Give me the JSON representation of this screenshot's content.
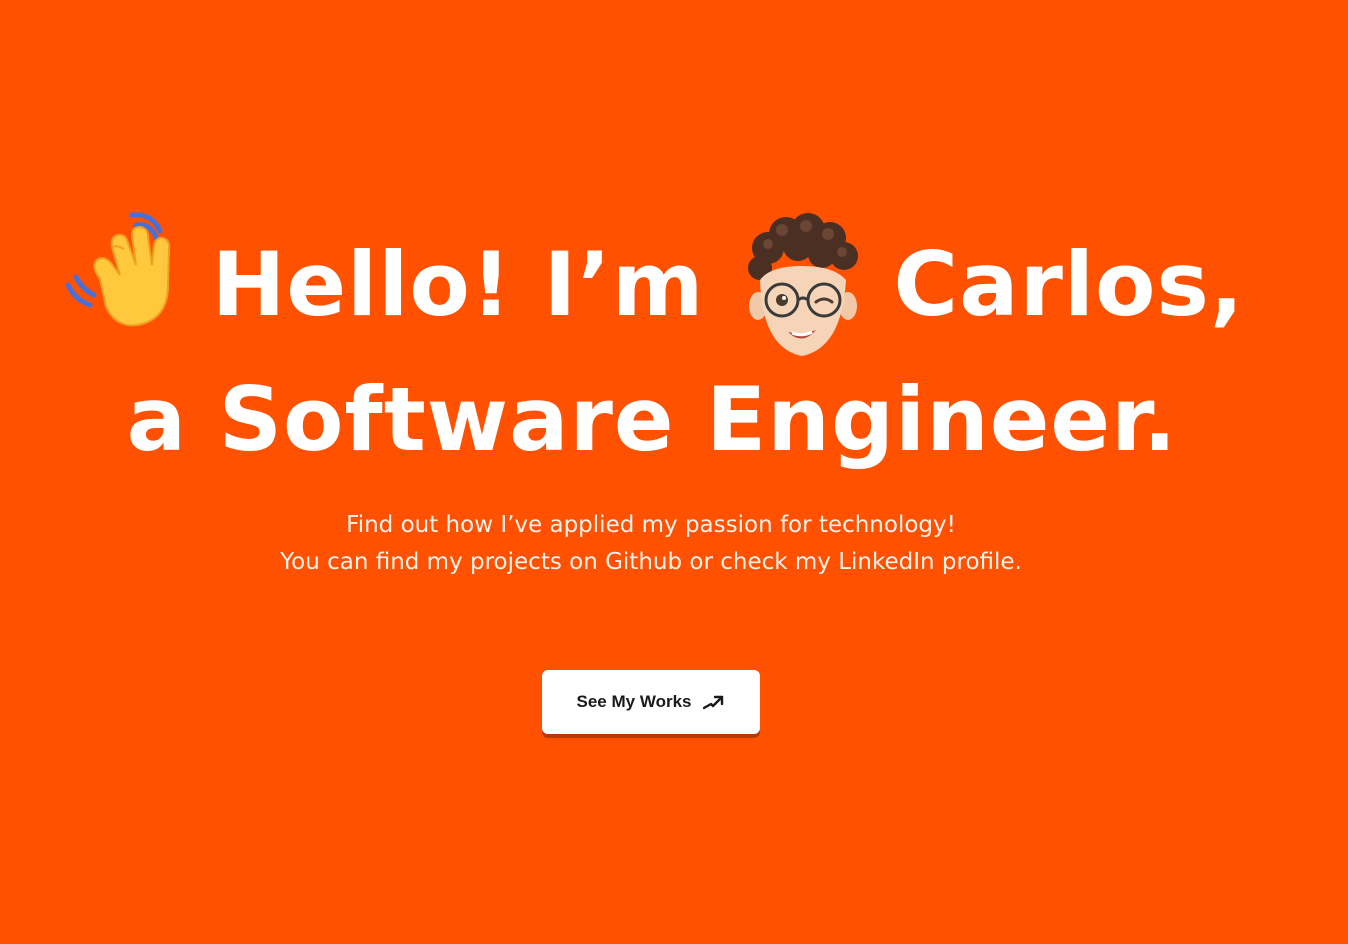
{
  "hero": {
    "line1_part1": "Hello! I’m",
    "line1_part2": "Carlos,",
    "line2": "a Software Engineer.",
    "hand_icon": "waving-hand-emoji",
    "avatar_icon": "memoji-avatar"
  },
  "subtitle": {
    "line1": "Find out how I’ve applied my passion for technology!",
    "line2": "You can find my projects on Github or check my LinkedIn profile."
  },
  "cta": {
    "label": "See My Works",
    "icon": "arrow-up-right-icon"
  },
  "colors": {
    "background": "#ff5100",
    "text": "#ffffff",
    "button_bg": "#ffffff",
    "button_text": "#1a1a1a"
  }
}
